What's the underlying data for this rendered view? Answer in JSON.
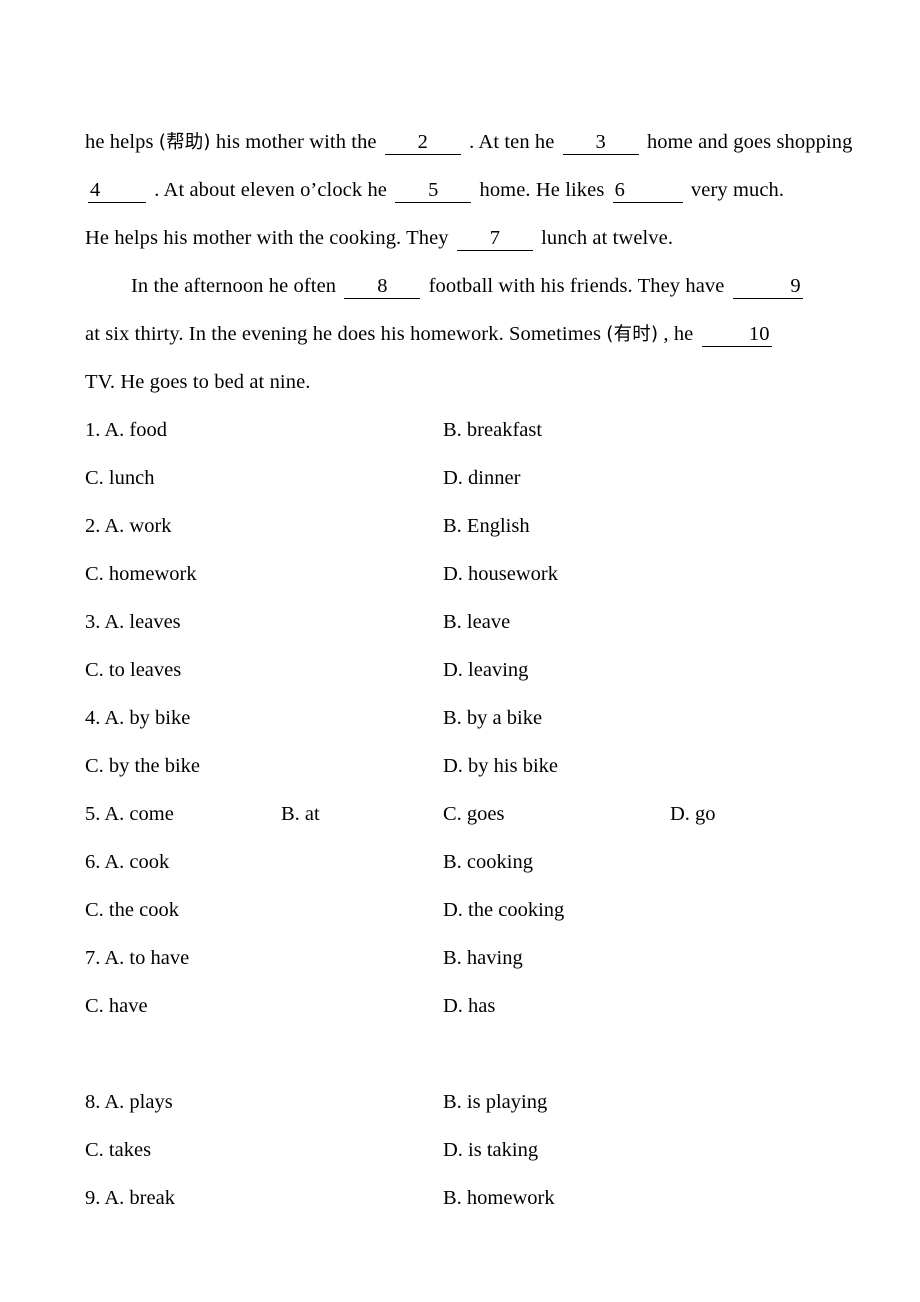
{
  "document": {
    "type": "cloze-test-worksheet",
    "language": "en-with-chinese-glosses"
  },
  "passage": {
    "lines": [
      {
        "id": "line-1",
        "indent": false,
        "segments": [
          {
            "kind": "text",
            "value": "he helps"
          },
          {
            "kind": "gloss",
            "value": "(帮助)"
          },
          {
            "kind": "text",
            "value": "his mother with the"
          },
          {
            "kind": "blank",
            "value": "2",
            "align": "center",
            "width": "wide"
          },
          {
            "kind": "text",
            "value": ". At ten he"
          },
          {
            "kind": "blank",
            "value": "3",
            "align": "center",
            "width": "wide"
          },
          {
            "kind": "text",
            "value": "home and"
          },
          {
            "kind": "text",
            "value": "goes shopping"
          }
        ]
      },
      {
        "id": "line-2",
        "indent": false,
        "segments": [
          {
            "kind": "blank",
            "value": "4",
            "align": "left",
            "width": "narrow"
          },
          {
            "kind": "text",
            "value": ". At about eleven o’clock he"
          },
          {
            "kind": "blank",
            "value": "5",
            "align": "center",
            "width": "wide"
          },
          {
            "kind": "text",
            "value": "home. He likes"
          },
          {
            "kind": "blank",
            "value": "6",
            "align": "left",
            "width": "mid"
          },
          {
            "kind": "text",
            "value": "very much."
          }
        ]
      },
      {
        "id": "line-3",
        "indent": false,
        "segments": [
          {
            "kind": "text",
            "value": "He helps his mother with the cooking. They"
          },
          {
            "kind": "blank",
            "value": "7",
            "align": "center",
            "width": "wide"
          },
          {
            "kind": "text",
            "value": "lunch at twelve."
          }
        ]
      },
      {
        "id": "line-4",
        "indent": true,
        "segments": [
          {
            "kind": "text",
            "value": "In the afternoon he often"
          },
          {
            "kind": "blank",
            "value": "8",
            "align": "center",
            "width": "wide"
          },
          {
            "kind": "text",
            "value": "football with his friends. They have"
          },
          {
            "kind": "blank",
            "value": "9",
            "align": "right",
            "width": "mid"
          }
        ]
      },
      {
        "id": "line-5",
        "indent": false,
        "segments": [
          {
            "kind": "text",
            "value": "at six thirty. In the evening he does his homework. Sometimes"
          },
          {
            "kind": "gloss",
            "value": "(有时)"
          },
          {
            "kind": "text",
            "value": ", he"
          },
          {
            "kind": "blank",
            "value": "10",
            "align": "right",
            "width": "mid"
          }
        ]
      },
      {
        "id": "line-6",
        "indent": false,
        "segments": [
          {
            "kind": "text",
            "value": "TV. He goes to bed at nine."
          }
        ]
      }
    ]
  },
  "questions": [
    {
      "number": "1",
      "layout": "two-column",
      "rows": [
        {
          "left": "1. A. food",
          "right": "B. breakfast"
        },
        {
          "left": "C. lunch",
          "right": "D. dinner"
        }
      ]
    },
    {
      "number": "2",
      "layout": "two-column",
      "rows": [
        {
          "left": "2. A. work",
          "right": "B. English"
        },
        {
          "left": "C. homework",
          "right": "D. housework"
        }
      ]
    },
    {
      "number": "3",
      "layout": "two-column",
      "rows": [
        {
          "left": "3. A. leaves",
          "right": "B. leave"
        },
        {
          "left": "C. to leaves",
          "right": "D. leaving"
        }
      ]
    },
    {
      "number": "4",
      "layout": "two-column",
      "rows": [
        {
          "left": "4. A. by bike",
          "right": "B. by a bike"
        },
        {
          "left": "C. by the bike",
          "right": "D. by his bike"
        }
      ]
    },
    {
      "number": "5",
      "layout": "four-column",
      "a": "5. A. come",
      "b": "B. at",
      "c": "C. goes",
      "d": "D. go"
    },
    {
      "number": "6",
      "layout": "two-column",
      "rows": [
        {
          "left": "6. A. cook",
          "right": "B. cooking"
        },
        {
          "left": "C. the cook",
          "right": "D. the cooking"
        }
      ]
    },
    {
      "number": "7",
      "layout": "two-column",
      "rows": [
        {
          "left": "7. A. to have",
          "right": "B. having"
        },
        {
          "left": "C. have",
          "right": "D. has"
        }
      ]
    },
    {
      "number": "8",
      "layout": "two-column",
      "rows": [
        {
          "left": "8. A. plays",
          "right": "B. is playing"
        },
        {
          "left": "C. takes",
          "right": "D. is taking"
        }
      ]
    },
    {
      "number": "9",
      "layout": "two-column",
      "rows": [
        {
          "left": "9. A. break",
          "right": "B. homework"
        }
      ]
    }
  ],
  "option_rows": [
    {
      "left": "1. A. food",
      "right": "B. breakfast",
      "gap_before": false
    },
    {
      "left": "C. lunch",
      "right": "D. dinner",
      "gap_before": false
    },
    {
      "left": "2. A. work",
      "right": "B. English",
      "gap_before": false
    },
    {
      "left": "C. homework",
      "right": "D. housework",
      "gap_before": false
    },
    {
      "left": "3. A. leaves",
      "right": "B. leave",
      "gap_before": false
    },
    {
      "left": "C. to leaves",
      "right": "D. leaving",
      "gap_before": false
    },
    {
      "left": "4. A. by bike",
      "right": "B. by a bike",
      "gap_before": false
    },
    {
      "left": "C. by the bike",
      "right": "D. by his bike",
      "gap_before": false
    },
    {
      "left": "6. A. cook",
      "right": "B. cooking",
      "gap_before": false
    },
    {
      "left": "C. the cook",
      "right": "D. the cooking",
      "gap_before": false
    },
    {
      "left": "7. A. to have",
      "right": "B. having",
      "gap_before": false
    },
    {
      "left": "C. have",
      "right": "D. has",
      "gap_before": false
    },
    {
      "left": "8. A. plays",
      "right": "B. is playing",
      "gap_before": true
    },
    {
      "left": "C. takes",
      "right": "D. is taking",
      "gap_before": false
    },
    {
      "left": "9. A. break",
      "right": "B. homework",
      "gap_before": false
    }
  ],
  "colors": {
    "text": "#000000",
    "background": "#ffffff",
    "rule": "#000000"
  }
}
